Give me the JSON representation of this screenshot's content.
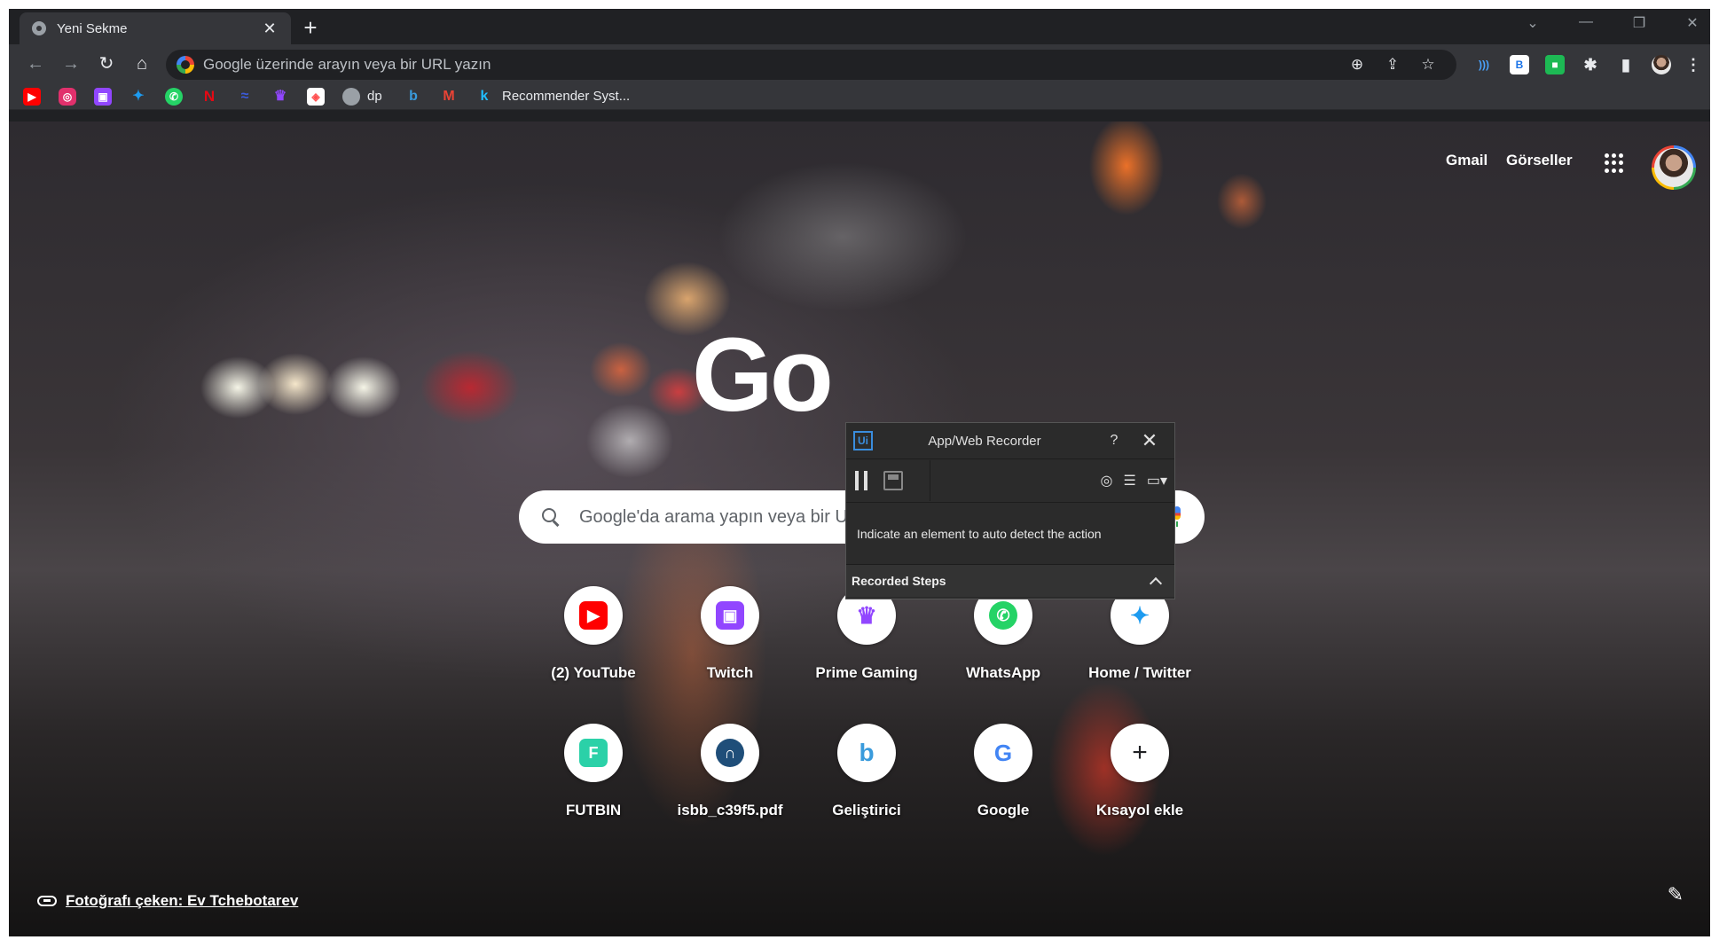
{
  "tab": {
    "title": "Yeni Sekme",
    "close": "✕",
    "new_tab": "+"
  },
  "window_controls": {
    "dropdown": "⌄",
    "minimize": "—",
    "restore": "❐",
    "close": "✕"
  },
  "toolbar": {
    "back": "←",
    "forward": "→",
    "reload": "↻",
    "home": "⌂",
    "omnibox_placeholder": "Google üzerinde arayın veya bir URL yazın",
    "zoom": "⊕",
    "share": "⇪",
    "star": "☆"
  },
  "extensions": [
    {
      "name": "wave-extension",
      "glyph": ")))",
      "color": "#4aa3ff"
    },
    {
      "name": "b-extension",
      "glyph": "B",
      "color": "#ffffff"
    },
    {
      "name": "green-extension",
      "glyph": "■",
      "color": "#1db954"
    },
    {
      "name": "puzzle-icon",
      "glyph": "✱",
      "color": "#e8eaed"
    },
    {
      "name": "sidepanel-icon",
      "glyph": "▮",
      "color": "#e8eaed"
    }
  ],
  "bookmarks": {
    "items": [
      {
        "name": "youtube",
        "glyph": "▶",
        "color": "#ff0000"
      },
      {
        "name": "instagram",
        "glyph": "◎",
        "color": "#e1306c"
      },
      {
        "name": "twitch",
        "glyph": "▣",
        "color": "#9146ff"
      },
      {
        "name": "twitter",
        "glyph": "✦",
        "color": "#1d9bf0"
      },
      {
        "name": "whatsapp",
        "glyph": "✆",
        "color": "#25d366"
      },
      {
        "name": "netflix",
        "glyph": "N",
        "color": "#e50914"
      },
      {
        "name": "prime",
        "glyph": "≈",
        "color": "#3b5bdb"
      },
      {
        "name": "prime-gaming",
        "glyph": "♛",
        "color": "#9146ff"
      },
      {
        "name": "app",
        "glyph": "◈",
        "color": "#ff4f4f"
      }
    ],
    "dp_label": "dp",
    "recommender_label": "Recommender Syst..."
  },
  "header": {
    "gmail": "Gmail",
    "images": "Görseller"
  },
  "search": {
    "placeholder": "Google'da arama yapın veya bir URL yazın"
  },
  "logo_text": "Go",
  "shortcuts": [
    {
      "label": "(2) YouTube",
      "glyph": "▶",
      "color": "#ff0000"
    },
    {
      "label": "Twitch",
      "glyph": "▣",
      "color": "#9146ff"
    },
    {
      "label": "Prime Gaming",
      "glyph": "♛",
      "color": "#9146ff"
    },
    {
      "label": "WhatsApp",
      "glyph": "✆",
      "color": "#25d366"
    },
    {
      "label": "Home / Twitter",
      "glyph": "✦",
      "color": "#1d9bf0"
    },
    {
      "label": "FUTBIN",
      "glyph": "F",
      "color": "#2bd1a8"
    },
    {
      "label": "isbb_c39f5.pdf",
      "glyph": "∩",
      "color": "#1f4e79"
    },
    {
      "label": "Geliştirici",
      "glyph": "b",
      "color": "#3a9bdc"
    },
    {
      "label": "Google",
      "glyph": "G",
      "color": "#4285f4"
    },
    {
      "label": "Kısayol ekle",
      "glyph": "+",
      "color": "#202124"
    }
  ],
  "credit": "Fotoğrafı çeken: Ev Tchebotarev",
  "recorder": {
    "title": "App/Web Recorder",
    "logo": "Ui",
    "help": "?",
    "close": "✕",
    "message": "Indicate an element to auto detect the action",
    "steps_label": "Recorded Steps"
  }
}
